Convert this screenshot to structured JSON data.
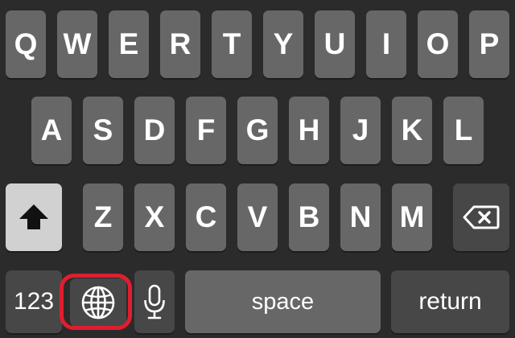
{
  "keyboard": {
    "row1": [
      "Q",
      "W",
      "E",
      "R",
      "T",
      "Y",
      "U",
      "I",
      "O",
      "P"
    ],
    "row2": [
      "A",
      "S",
      "D",
      "F",
      "G",
      "H",
      "J",
      "K",
      "L"
    ],
    "row3": [
      "Z",
      "X",
      "C",
      "V",
      "B",
      "N",
      "M"
    ],
    "bottom": {
      "numbers_label": "123",
      "space_label": "space",
      "return_label": "return"
    }
  },
  "icons": {
    "shift": "shift-arrow-up-filled",
    "delete": "backspace-x",
    "globe": "globe",
    "mic": "microphone"
  },
  "highlight": {
    "target": "globe-key",
    "color": "#e01e2f"
  },
  "colors": {
    "background": "#2b2b2b",
    "key": "#676767",
    "function_key": "#474747",
    "shift_active": "#d1d1d1"
  }
}
